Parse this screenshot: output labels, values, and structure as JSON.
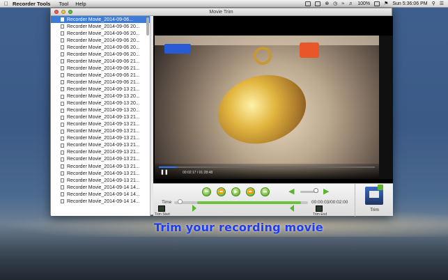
{
  "menubar": {
    "app_name": "Recorder Tools",
    "menus": [
      "Tool",
      "Help"
    ],
    "battery": "100%",
    "clock": "Sun 5:36:06 PM"
  },
  "window": {
    "title": "Movie Trim"
  },
  "files": [
    "Recorder Movie_2014-09-06...",
    "Recorder Movie_2014-09-06 20...",
    "Recorder Movie_2014-09-06 20...",
    "Recorder Movie_2014-09-06 20...",
    "Recorder Movie_2014-09-06 20...",
    "Recorder Movie_2014-09-06 20...",
    "Recorder Movie_2014-09-06 21...",
    "Recorder Movie_2014-09-06 21...",
    "Recorder Movie_2014-09-06 21...",
    "Recorder Movie_2014-09-06 21...",
    "Recorder Movie_2014-09-13 21...",
    "Recorder Movie_2014-09-13 20...",
    "Recorder Movie_2014-09-13 20...",
    "Recorder Movie_2014-09-13 20...",
    "Recorder Movie_2014-09-13 21...",
    "Recorder Movie_2014-09-13 21...",
    "Recorder Movie_2014-09-13 21...",
    "Recorder Movie_2014-09-13 21...",
    "Recorder Movie_2014-09-13 21...",
    "Recorder Movie_2014-09-13 21...",
    "Recorder Movie_2014-09-13 21...",
    "Recorder Movie_2014-09-13 21...",
    "Recorder Movie_2014-09-13 21...",
    "Recorder Movie_2014-09-13 21...",
    "Recorder Movie_2014-09-14 14...",
    "Recorder Movie_2014-09-14 14...",
    "Recorder Movie_2014-09-14 14..."
  ],
  "selected_index": 0,
  "video": {
    "time": "00:02:17 / 01:28:48",
    "progress": 0.08
  },
  "controls": {
    "time_label": "Time",
    "time_counter": "00:00:03/00:02:00",
    "trim_start_label": "Trim Start",
    "trim_end_label": "Trim End",
    "trim_label": "Trim",
    "volume": 0.85,
    "trim_range": [
      0.17,
      0.95
    ]
  },
  "caption": "Trim your recording movie",
  "colors": {
    "accent_green": "#6ec13a",
    "selection_blue": "#3d7bd8",
    "caption_blue": "#1f3cf0"
  }
}
